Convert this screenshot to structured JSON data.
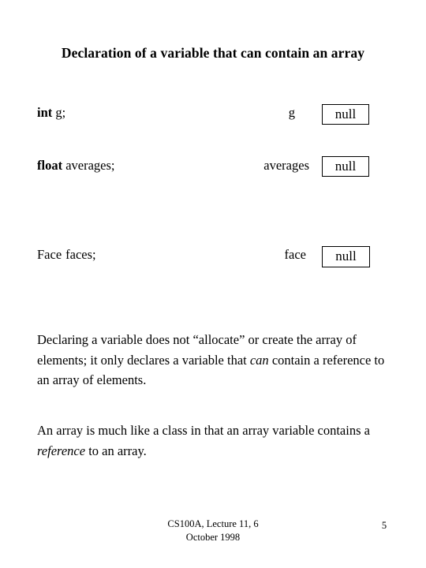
{
  "slide": {
    "title": "Declaration of a variable that can contain an array",
    "declarations": [
      {
        "keyword": "int",
        "variable": "g;",
        "label": "g",
        "value": "null"
      },
      {
        "keyword": "float",
        "variable": "averages;",
        "label": "averages",
        "value": "null"
      },
      {
        "keyword": "Face",
        "variable": "faces;",
        "label": "face",
        "value": "null"
      }
    ],
    "paragraphs": [
      {
        "part1": "Declaring a variable does not “allocate” or create the array of elements; it only declares a variable that ",
        "emphasis": "can",
        "part2": " contain a reference to an array of elements."
      },
      {
        "part1": "An array is much like a class in that an array variable contains a ",
        "emphasis": "reference",
        "part2": " to an array."
      }
    ],
    "footer": {
      "line1": "CS100A, Lecture 11, 6",
      "line2": "October 1998",
      "page_number": "5"
    }
  }
}
